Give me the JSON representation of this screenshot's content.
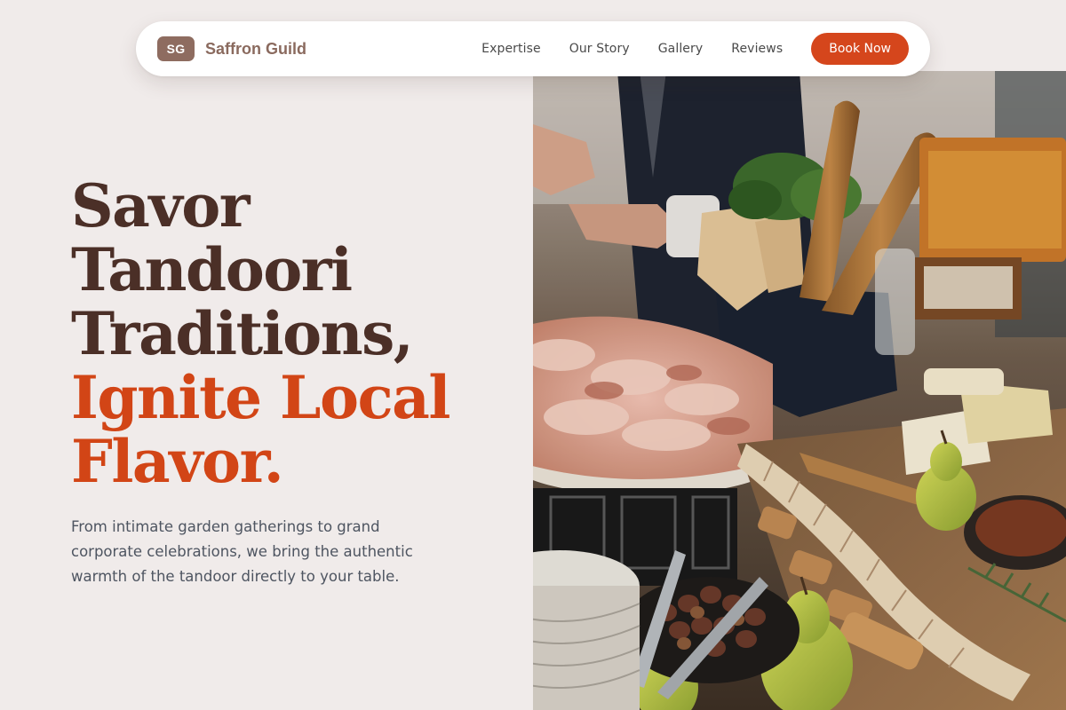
{
  "nav": {
    "logo_initials": "SG",
    "brand_name": "Saffron Guild",
    "links": [
      "Expertise",
      "Our Story",
      "Gallery",
      "Reviews"
    ],
    "cta_label": "Book Now"
  },
  "hero": {
    "headline_line1": "Savor",
    "headline_line2": "Tandoori",
    "headline_line3": "Traditions,",
    "headline_accent_line1": "Ignite Local",
    "headline_accent_line2": "Flavor.",
    "subtext": "From intimate garden gatherings to grand corporate celebrations, we bring the authentic warmth of the tandoor directly to your table.",
    "image_subject": "catering buffet spread with breads, cured meats, cheeses, olives and pears"
  },
  "colors": {
    "background": "#f0ebea",
    "accent": "#d5461c",
    "headline_dark": "#4b2f27",
    "logo_badge": "#8e6c60",
    "body_text": "#4e5561"
  }
}
